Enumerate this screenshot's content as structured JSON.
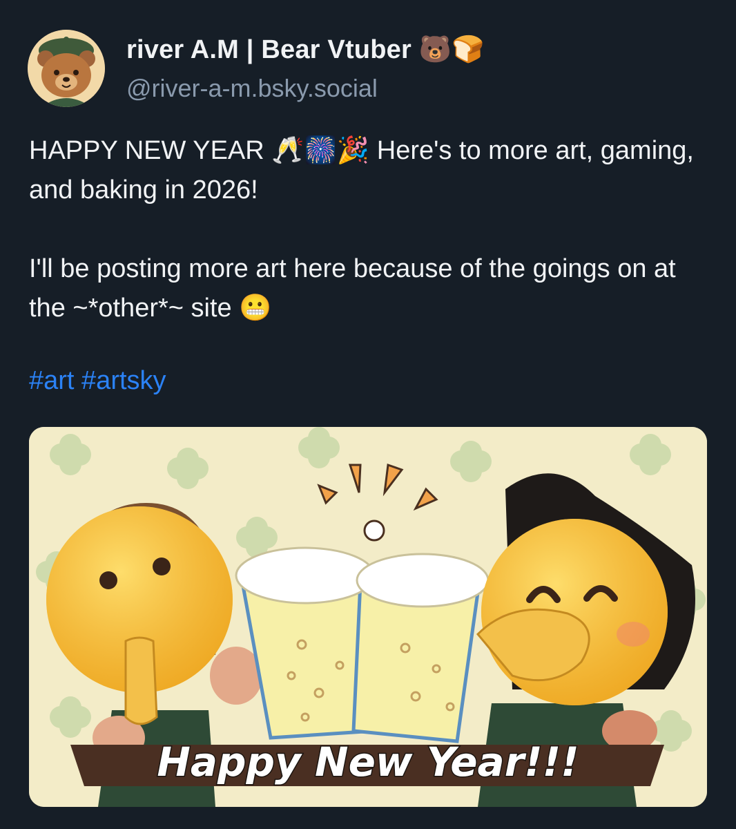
{
  "author": {
    "display_name": "river A.M | Bear Vtuber 🐻🍞",
    "handle": "@river-a-m.bsky.social",
    "avatar_icon": "bear-avatar-icon"
  },
  "post": {
    "line1": "HAPPY NEW YEAR 🥂🎆🎉 Here's to more art, gaming, and baking in 2026!",
    "line2": "I'll be posting more art here because of the goings on at the ~*other*~ site 😬",
    "hashtags": [
      "#art",
      "#artsky"
    ]
  },
  "image": {
    "caption": "Happy New Year!!!",
    "background_color": "#f3ecc8",
    "clover_color": "#c9d8a8"
  },
  "colors": {
    "background": "#161e27",
    "text": "#f1f3f5",
    "handle": "#8a9aad",
    "link": "#2b82f6"
  }
}
